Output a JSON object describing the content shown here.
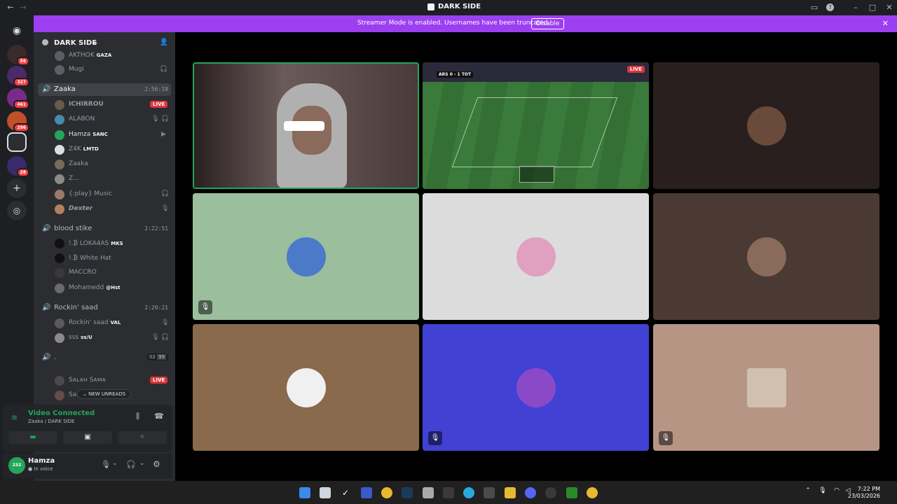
{
  "window": {
    "title": "DARK SIDE"
  },
  "banner": {
    "text": "Streamer Mode is enabled. Usernames have been truncated.",
    "disable_label": "Disable"
  },
  "rail": {
    "badges": [
      "56",
      "327",
      "461",
      "296",
      "28"
    ]
  },
  "server": {
    "name": "DARK SIDE"
  },
  "top_users": [
    {
      "name": "AKTHOK",
      "tag": "GAZA"
    },
    {
      "name": "Mugi"
    }
  ],
  "channels": [
    {
      "name": "Zaaka",
      "time": "2:56:19",
      "users": [
        {
          "name": "ICHIRROU",
          "live": "LIVE"
        },
        {
          "name": "ALABON"
        },
        {
          "name": "Hamza",
          "tag": "SANC"
        },
        {
          "name": "Z4K",
          "tag": "LMTD"
        },
        {
          "name": "Zaaka"
        },
        {
          "name": "Z..."
        },
        {
          "name": "{:play} Music"
        },
        {
          "name": "Dexter"
        }
      ]
    },
    {
      "name": "blood stike",
      "time": "2:22:51",
      "users": [
        {
          "name": "!.₿ LOKA4AS",
          "tag": "MKS"
        },
        {
          "name": "!.₿ White Hat"
        },
        {
          "name": "MACCRO"
        },
        {
          "name": "Mohamedd",
          "tag": "@Hst"
        }
      ]
    },
    {
      "name": "Rockin' saad",
      "time": "2:20:21",
      "users": [
        {
          "name": "Rockin' saad",
          "tag": "VAL"
        },
        {
          "name": "ꜱꜱꜱ",
          "tag": "ꜱꜱ/U"
        }
      ]
    },
    {
      "name": ".",
      "counter": [
        "02",
        "99"
      ],
      "users": [
        {
          "name": "Sᴀʟᴀʜ Sᴀᴍᴀ",
          "live": "LIVE"
        },
        {
          "name": "Sa..."
        }
      ]
    }
  ],
  "new_unreads": "NEW UNREADS",
  "voice": {
    "status": "Video Connected",
    "channel": "Zaaka / DARK SIDE"
  },
  "user": {
    "name": "Hamza",
    "status": "In voice",
    "avatar_text": "232"
  },
  "stream": {
    "live": "LIVE",
    "home": "ARS",
    "away": "TOT",
    "score": "0 - 1"
  },
  "tiles": [
    {
      "type": "camera"
    },
    {
      "type": "stream"
    },
    {
      "bg": "#2a1f1f"
    },
    {
      "bg": "#9bbf9c",
      "muted": true
    },
    {
      "bg": "#dcdcdc"
    },
    {
      "bg": "#4a3a33"
    },
    {
      "bg": "#8a6a4d"
    },
    {
      "bg": "#4141d4",
      "muted": true
    },
    {
      "bg": "#b69585",
      "muted": true
    }
  ],
  "clock": {
    "time": "7:22 PM",
    "date": "23/03/2026"
  }
}
